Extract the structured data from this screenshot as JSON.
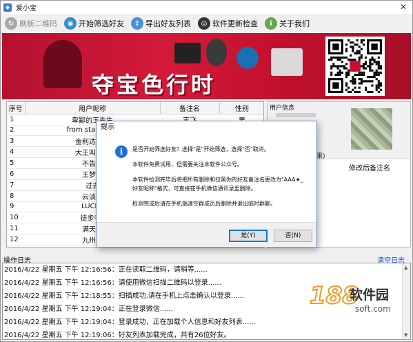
{
  "window": {
    "title": "爱小宝",
    "close_glyph": "✕"
  },
  "toolbar": [
    {
      "label": "刷新二维码",
      "icon": "refresh-icon",
      "color": "#a8a8a8",
      "glyph": "↻",
      "enabled": false
    },
    {
      "label": "开始筛选好友",
      "icon": "filter-icon",
      "color": "#2f8fd8",
      "glyph": "◉",
      "enabled": true
    },
    {
      "label": "导出好友列表",
      "icon": "export-icon",
      "color": "#4a90d9",
      "glyph": "⇪",
      "enabled": true
    },
    {
      "label": "软件更新检查",
      "icon": "update-icon",
      "color": "#333333",
      "glyph": "◎",
      "enabled": true
    },
    {
      "label": "关于我们",
      "icon": "info-icon",
      "color": "#6aa84f",
      "glyph": "i",
      "enabled": true
    }
  ],
  "banner": {
    "slogan": "夺宝色行时",
    "bg_color": "#c0102c"
  },
  "users": {
    "columns": [
      "序号",
      "用户昵称",
      "备注名",
      "性别"
    ],
    "rows": [
      [
        "1",
        "卑鄙的王先生",
        "王飞",
        "男"
      ],
      [
        "2",
        "from starts to t",
        "",
        ""
      ],
      [
        "3",
        "金利达办公",
        "",
        ""
      ],
      [
        "4",
        "大王叫我来",
        "",
        ""
      ],
      [
        "5",
        "不告诉",
        "",
        ""
      ],
      [
        "6",
        "王梦龙",
        "",
        ""
      ],
      [
        "7",
        "过去",
        "",
        ""
      ],
      [
        "8",
        "云淡风",
        "",
        ""
      ],
      [
        "9",
        "LUCKY",
        "",
        ""
      ],
      [
        "10",
        "徒步者_",
        "",
        ""
      ],
      [
        "11",
        "满天流",
        "",
        ""
      ],
      [
        "12",
        "九州财",
        "",
        ""
      ]
    ]
  },
  "info_panel": {
    "title": "用户信息",
    "result_label": "结果)",
    "column": "修改后备注名"
  },
  "log": {
    "label": "操作日志",
    "clear_label": "清空日志",
    "lines": [
      "2016/4/22 星期五 下午 12:16:56：正在读取二维码，请稍等......",
      "2016/4/22 星期五 下午 12:16:56：请使用微信扫描二维码以登录......",
      "2016/4/22 星期五 下午 12:18:55：扫描成功,请在手机上点击确认以登录......",
      "2016/4/22 星期五 下午 12:19:04：正在登录微信......",
      "2016/4/22 星期五 下午 12:19:04：登录成功，正在加载个人信息和好友列表......",
      "2016/4/22 星期五 下午 12:19:06：好友列表加载完成，共有26位好友。"
    ]
  },
  "watermark": {
    "number": "188",
    "name": "软件园",
    "url": "soft.com"
  },
  "dialog": {
    "title": "提示",
    "paragraphs": [
      "是否开始筛选好友？选择\"是\"开始筛选，选择\"否\"取消。",
      "本软件免费试用，但需要关注本软件公众号。",
      "本软件检测完毕后将把所有删除和拉黑你的好友备注名更改为\"AAA★_\n好友昵称\"格式，可直接在手机微信通讯录里删除。",
      "检测完成后请在手机端清空群成员后删除并退出临时群聊。"
    ],
    "yes_label": "是(Y)",
    "no_label": "否(N)"
  }
}
